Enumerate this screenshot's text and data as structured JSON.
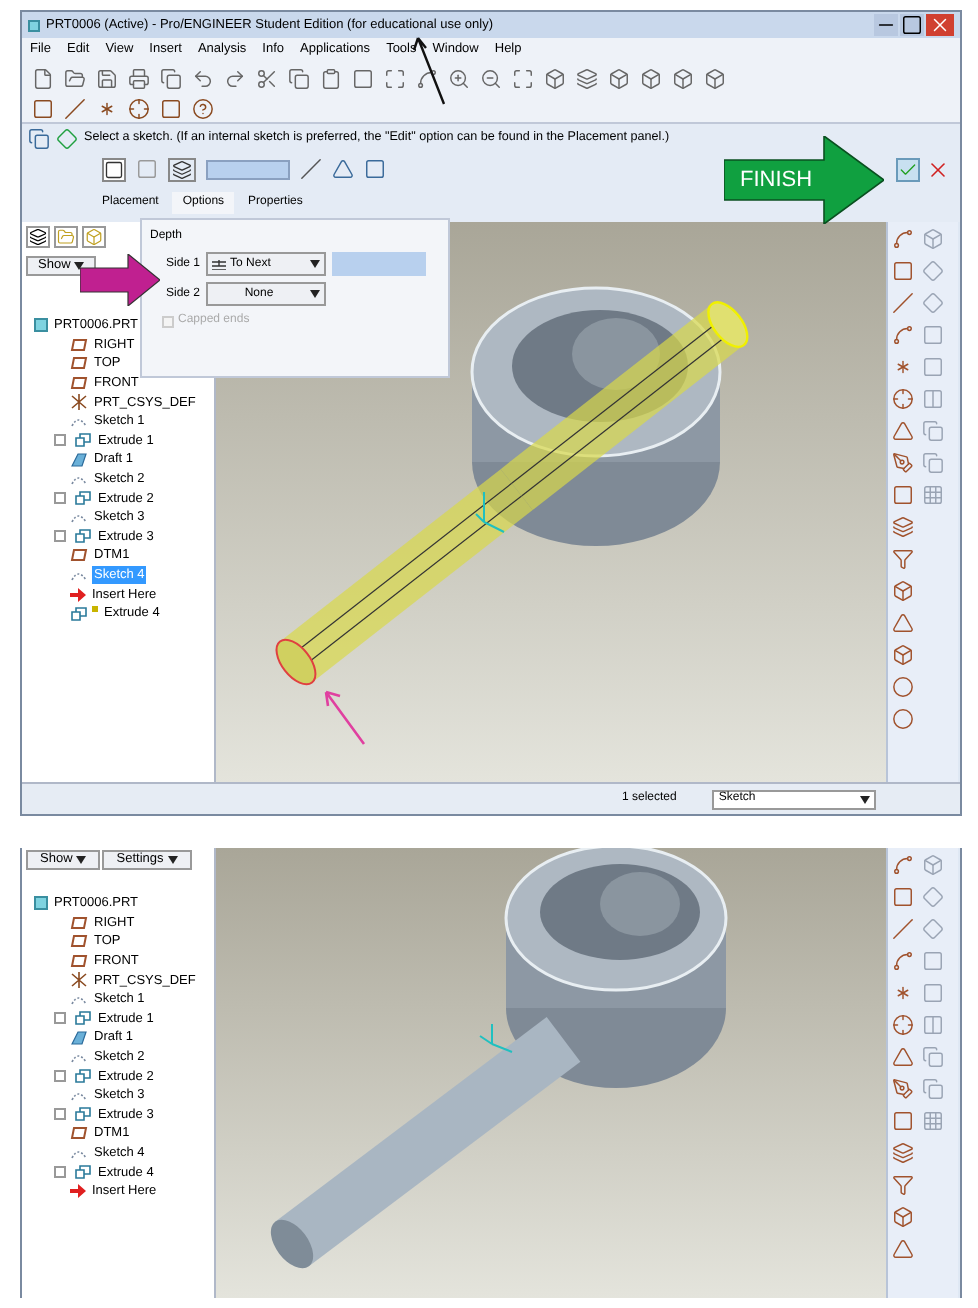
{
  "window": {
    "title": "PRT0006 (Active) - Pro/ENGINEER Student Edition (for educational use only)"
  },
  "menu": [
    "File",
    "Edit",
    "View",
    "Insert",
    "Analysis",
    "Info",
    "Applications",
    "Tools",
    "Window",
    "Help"
  ],
  "prompt": "Select a sketch. (If an internal sketch is preferred, the \"Edit\" option can be found in the Placement panel.)",
  "dashboard_tabs": [
    {
      "label": "Placement",
      "selected": false
    },
    {
      "label": "Options",
      "selected": true
    },
    {
      "label": "Properties",
      "selected": false
    }
  ],
  "options_panel": {
    "heading": "Depth",
    "side_1": {
      "label": "Side 1",
      "value": "To Next"
    },
    "side_2": {
      "label": "Side 2",
      "value": "None"
    },
    "capped_ends": {
      "label": "Capped ends",
      "checked": false,
      "disabled": true
    }
  },
  "annotations": {
    "finish": "FINISH"
  },
  "top_panel": {
    "show_button": "Show",
    "tree": [
      {
        "label": "PRT0006.PRT",
        "kind": "part",
        "selected": false,
        "children": [
          {
            "label": "RIGHT",
            "kind": "datum",
            "selected": false
          },
          {
            "label": "TOP",
            "kind": "datum",
            "selected": false
          },
          {
            "label": "FRONT",
            "kind": "datum",
            "selected": false
          },
          {
            "label": "PRT_CSYS_DEF",
            "kind": "csys",
            "selected": false
          },
          {
            "label": "Sketch 1",
            "kind": "sketch",
            "selected": false
          },
          {
            "label": "Extrude 1",
            "kind": "extrude",
            "selected": false
          },
          {
            "label": "Draft 1",
            "kind": "draft",
            "selected": false
          },
          {
            "label": "Sketch 2",
            "kind": "sketch",
            "selected": false
          },
          {
            "label": "Extrude 2",
            "kind": "extrude",
            "selected": false
          },
          {
            "label": "Sketch 3",
            "kind": "sketch",
            "selected": false
          },
          {
            "label": "Extrude 3",
            "kind": "extrude",
            "selected": false
          },
          {
            "label": "DTM1",
            "kind": "datum",
            "selected": false
          },
          {
            "label": "Sketch 4",
            "kind": "sketch",
            "selected": true
          },
          {
            "label": "Insert Here",
            "kind": "insert",
            "selected": false
          },
          {
            "label": "Extrude 4",
            "kind": "pending",
            "selected": false
          }
        ]
      }
    ]
  },
  "status_bar": {
    "selection": "1 selected",
    "filter": "Sketch"
  },
  "bottom_panel": {
    "show_button": "Show",
    "settings_button": "Settings",
    "tree": [
      {
        "label": "PRT0006.PRT",
        "kind": "part",
        "selected": false,
        "children": [
          {
            "label": "RIGHT",
            "kind": "datum",
            "selected": false
          },
          {
            "label": "TOP",
            "kind": "datum",
            "selected": false
          },
          {
            "label": "FRONT",
            "kind": "datum",
            "selected": false
          },
          {
            "label": "PRT_CSYS_DEF",
            "kind": "csys",
            "selected": false
          },
          {
            "label": "Sketch 1",
            "kind": "sketch",
            "selected": false
          },
          {
            "label": "Extrude 1",
            "kind": "extrude",
            "selected": false
          },
          {
            "label": "Draft 1",
            "kind": "draft",
            "selected": false
          },
          {
            "label": "Sketch 2",
            "kind": "sketch",
            "selected": false
          },
          {
            "label": "Extrude 2",
            "kind": "extrude",
            "selected": false
          },
          {
            "label": "Sketch 3",
            "kind": "sketch",
            "selected": false
          },
          {
            "label": "Extrude 3",
            "kind": "extrude",
            "selected": false
          },
          {
            "label": "DTM1",
            "kind": "datum",
            "selected": false
          },
          {
            "label": "Sketch 4",
            "kind": "sketch",
            "selected": false
          },
          {
            "label": "Extrude 4",
            "kind": "extrude",
            "selected": false
          },
          {
            "label": "Insert Here",
            "kind": "insert",
            "selected": false
          }
        ]
      }
    ]
  }
}
